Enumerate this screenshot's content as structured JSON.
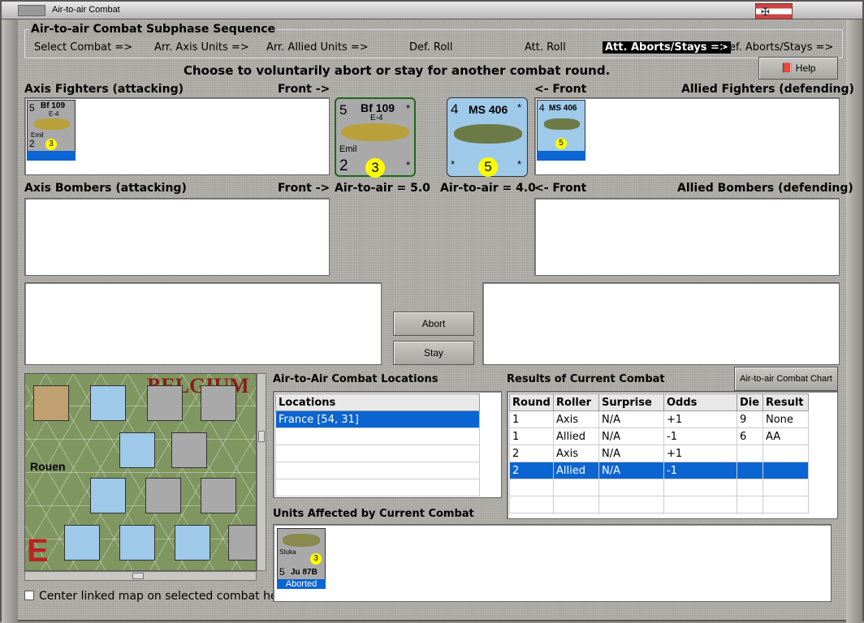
{
  "window": {
    "title": "Air-to-air Combat",
    "flag_symbol": "✠"
  },
  "subphase": {
    "heading": "Air-to-air Combat Subphase Sequence",
    "steps": [
      {
        "label": "Select Combat =>"
      },
      {
        "label": "Arr. Axis Units =>"
      },
      {
        "label": "Arr. Allied Units =>"
      },
      {
        "label": "Def. Roll"
      },
      {
        "label": "Att. Roll"
      },
      {
        "label": "Att. Aborts/Stays =>",
        "active": true
      },
      {
        "label": "Def. Aborts/Stays =>"
      }
    ]
  },
  "prompt": "Choose to voluntarily abort or stay for another combat round.",
  "help_label": "Help",
  "labels": {
    "axis_fighters": "Axis Fighters (attacking)",
    "front_right": "Front ->",
    "front_left": "<- Front",
    "allied_fighters": "Allied Fighters (defending)",
    "axis_bombers": "Axis Bombers (attacking)",
    "allied_bombers": "Allied Bombers (defending)",
    "axis_ata": "Air-to-air = 5.0",
    "allied_ata": "Air-to-air = 4.0"
  },
  "axis_counter": {
    "name": "Bf 109",
    "variant": "E-4",
    "nick": "Emil",
    "top_left": "5",
    "bottom_left": "2",
    "circle": "3",
    "star": "*",
    "color": "#a9a9a9"
  },
  "allied_counter": {
    "name": "MS 406",
    "top_left": "4",
    "circle": "5",
    "star": "*",
    "color": "#9ec9e8"
  },
  "buttons": {
    "abort": "Abort",
    "stay": "Stay",
    "chart": "Air-to-air Combat Chart"
  },
  "locations": {
    "title": "Air-to-Air Combat Locations",
    "header": "Locations",
    "items": [
      "France [54, 31]"
    ]
  },
  "results": {
    "title": "Results of Current Combat",
    "columns": [
      "Round",
      "Roller",
      "Surprise",
      "Odds",
      "Die",
      "Result"
    ],
    "rows": [
      [
        "1",
        "Axis",
        "N/A",
        "+1",
        "9",
        "None"
      ],
      [
        "1",
        "Allied",
        "N/A",
        "-1",
        "6",
        "AA"
      ],
      [
        "2",
        "Axis",
        "N/A",
        "+1",
        "",
        ""
      ],
      [
        "2",
        "Allied",
        "N/A",
        "-1",
        "",
        ""
      ]
    ]
  },
  "affected": {
    "title": "Units Affected by Current Combat",
    "unit": {
      "name": "Ju 87B",
      "nick": "Stuka",
      "top_left": "5",
      "circle": "3",
      "status": "Aborted"
    }
  },
  "map": {
    "place": "Rouen",
    "region": "BELGIUM",
    "checkbox_label": "Center linked map on selected combat hex"
  }
}
